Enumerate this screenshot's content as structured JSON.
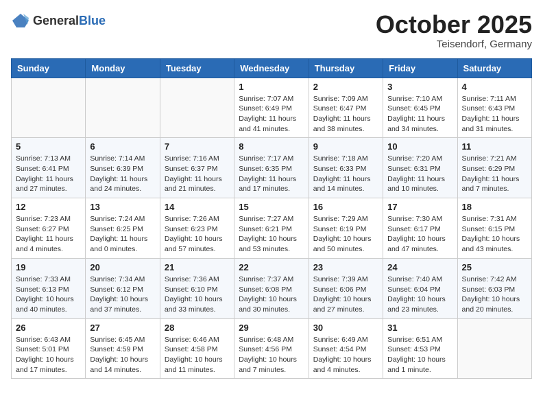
{
  "logo": {
    "text_general": "General",
    "text_blue": "Blue"
  },
  "title": {
    "month": "October 2025",
    "location": "Teisendorf, Germany"
  },
  "weekdays": [
    "Sunday",
    "Monday",
    "Tuesday",
    "Wednesday",
    "Thursday",
    "Friday",
    "Saturday"
  ],
  "weeks": [
    [
      {
        "day": "",
        "info": ""
      },
      {
        "day": "",
        "info": ""
      },
      {
        "day": "",
        "info": ""
      },
      {
        "day": "1",
        "sunrise": "7:07 AM",
        "sunset": "6:49 PM",
        "daylight": "11 hours and 41 minutes."
      },
      {
        "day": "2",
        "sunrise": "7:09 AM",
        "sunset": "6:47 PM",
        "daylight": "11 hours and 38 minutes."
      },
      {
        "day": "3",
        "sunrise": "7:10 AM",
        "sunset": "6:45 PM",
        "daylight": "11 hours and 34 minutes."
      },
      {
        "day": "4",
        "sunrise": "7:11 AM",
        "sunset": "6:43 PM",
        "daylight": "11 hours and 31 minutes."
      }
    ],
    [
      {
        "day": "5",
        "sunrise": "7:13 AM",
        "sunset": "6:41 PM",
        "daylight": "11 hours and 27 minutes."
      },
      {
        "day": "6",
        "sunrise": "7:14 AM",
        "sunset": "6:39 PM",
        "daylight": "11 hours and 24 minutes."
      },
      {
        "day": "7",
        "sunrise": "7:16 AM",
        "sunset": "6:37 PM",
        "daylight": "11 hours and 21 minutes."
      },
      {
        "day": "8",
        "sunrise": "7:17 AM",
        "sunset": "6:35 PM",
        "daylight": "11 hours and 17 minutes."
      },
      {
        "day": "9",
        "sunrise": "7:18 AM",
        "sunset": "6:33 PM",
        "daylight": "11 hours and 14 minutes."
      },
      {
        "day": "10",
        "sunrise": "7:20 AM",
        "sunset": "6:31 PM",
        "daylight": "11 hours and 10 minutes."
      },
      {
        "day": "11",
        "sunrise": "7:21 AM",
        "sunset": "6:29 PM",
        "daylight": "11 hours and 7 minutes."
      }
    ],
    [
      {
        "day": "12",
        "sunrise": "7:23 AM",
        "sunset": "6:27 PM",
        "daylight": "11 hours and 4 minutes."
      },
      {
        "day": "13",
        "sunrise": "7:24 AM",
        "sunset": "6:25 PM",
        "daylight": "11 hours and 0 minutes."
      },
      {
        "day": "14",
        "sunrise": "7:26 AM",
        "sunset": "6:23 PM",
        "daylight": "10 hours and 57 minutes."
      },
      {
        "day": "15",
        "sunrise": "7:27 AM",
        "sunset": "6:21 PM",
        "daylight": "10 hours and 53 minutes."
      },
      {
        "day": "16",
        "sunrise": "7:29 AM",
        "sunset": "6:19 PM",
        "daylight": "10 hours and 50 minutes."
      },
      {
        "day": "17",
        "sunrise": "7:30 AM",
        "sunset": "6:17 PM",
        "daylight": "10 hours and 47 minutes."
      },
      {
        "day": "18",
        "sunrise": "7:31 AM",
        "sunset": "6:15 PM",
        "daylight": "10 hours and 43 minutes."
      }
    ],
    [
      {
        "day": "19",
        "sunrise": "7:33 AM",
        "sunset": "6:13 PM",
        "daylight": "10 hours and 40 minutes."
      },
      {
        "day": "20",
        "sunrise": "7:34 AM",
        "sunset": "6:12 PM",
        "daylight": "10 hours and 37 minutes."
      },
      {
        "day": "21",
        "sunrise": "7:36 AM",
        "sunset": "6:10 PM",
        "daylight": "10 hours and 33 minutes."
      },
      {
        "day": "22",
        "sunrise": "7:37 AM",
        "sunset": "6:08 PM",
        "daylight": "10 hours and 30 minutes."
      },
      {
        "day": "23",
        "sunrise": "7:39 AM",
        "sunset": "6:06 PM",
        "daylight": "10 hours and 27 minutes."
      },
      {
        "day": "24",
        "sunrise": "7:40 AM",
        "sunset": "6:04 PM",
        "daylight": "10 hours and 23 minutes."
      },
      {
        "day": "25",
        "sunrise": "7:42 AM",
        "sunset": "6:03 PM",
        "daylight": "10 hours and 20 minutes."
      }
    ],
    [
      {
        "day": "26",
        "sunrise": "6:43 AM",
        "sunset": "5:01 PM",
        "daylight": "10 hours and 17 minutes."
      },
      {
        "day": "27",
        "sunrise": "6:45 AM",
        "sunset": "4:59 PM",
        "daylight": "10 hours and 14 minutes."
      },
      {
        "day": "28",
        "sunrise": "6:46 AM",
        "sunset": "4:58 PM",
        "daylight": "10 hours and 11 minutes."
      },
      {
        "day": "29",
        "sunrise": "6:48 AM",
        "sunset": "4:56 PM",
        "daylight": "10 hours and 7 minutes."
      },
      {
        "day": "30",
        "sunrise": "6:49 AM",
        "sunset": "4:54 PM",
        "daylight": "10 hours and 4 minutes."
      },
      {
        "day": "31",
        "sunrise": "6:51 AM",
        "sunset": "4:53 PM",
        "daylight": "10 hours and 1 minute."
      },
      {
        "day": "",
        "info": ""
      }
    ]
  ]
}
